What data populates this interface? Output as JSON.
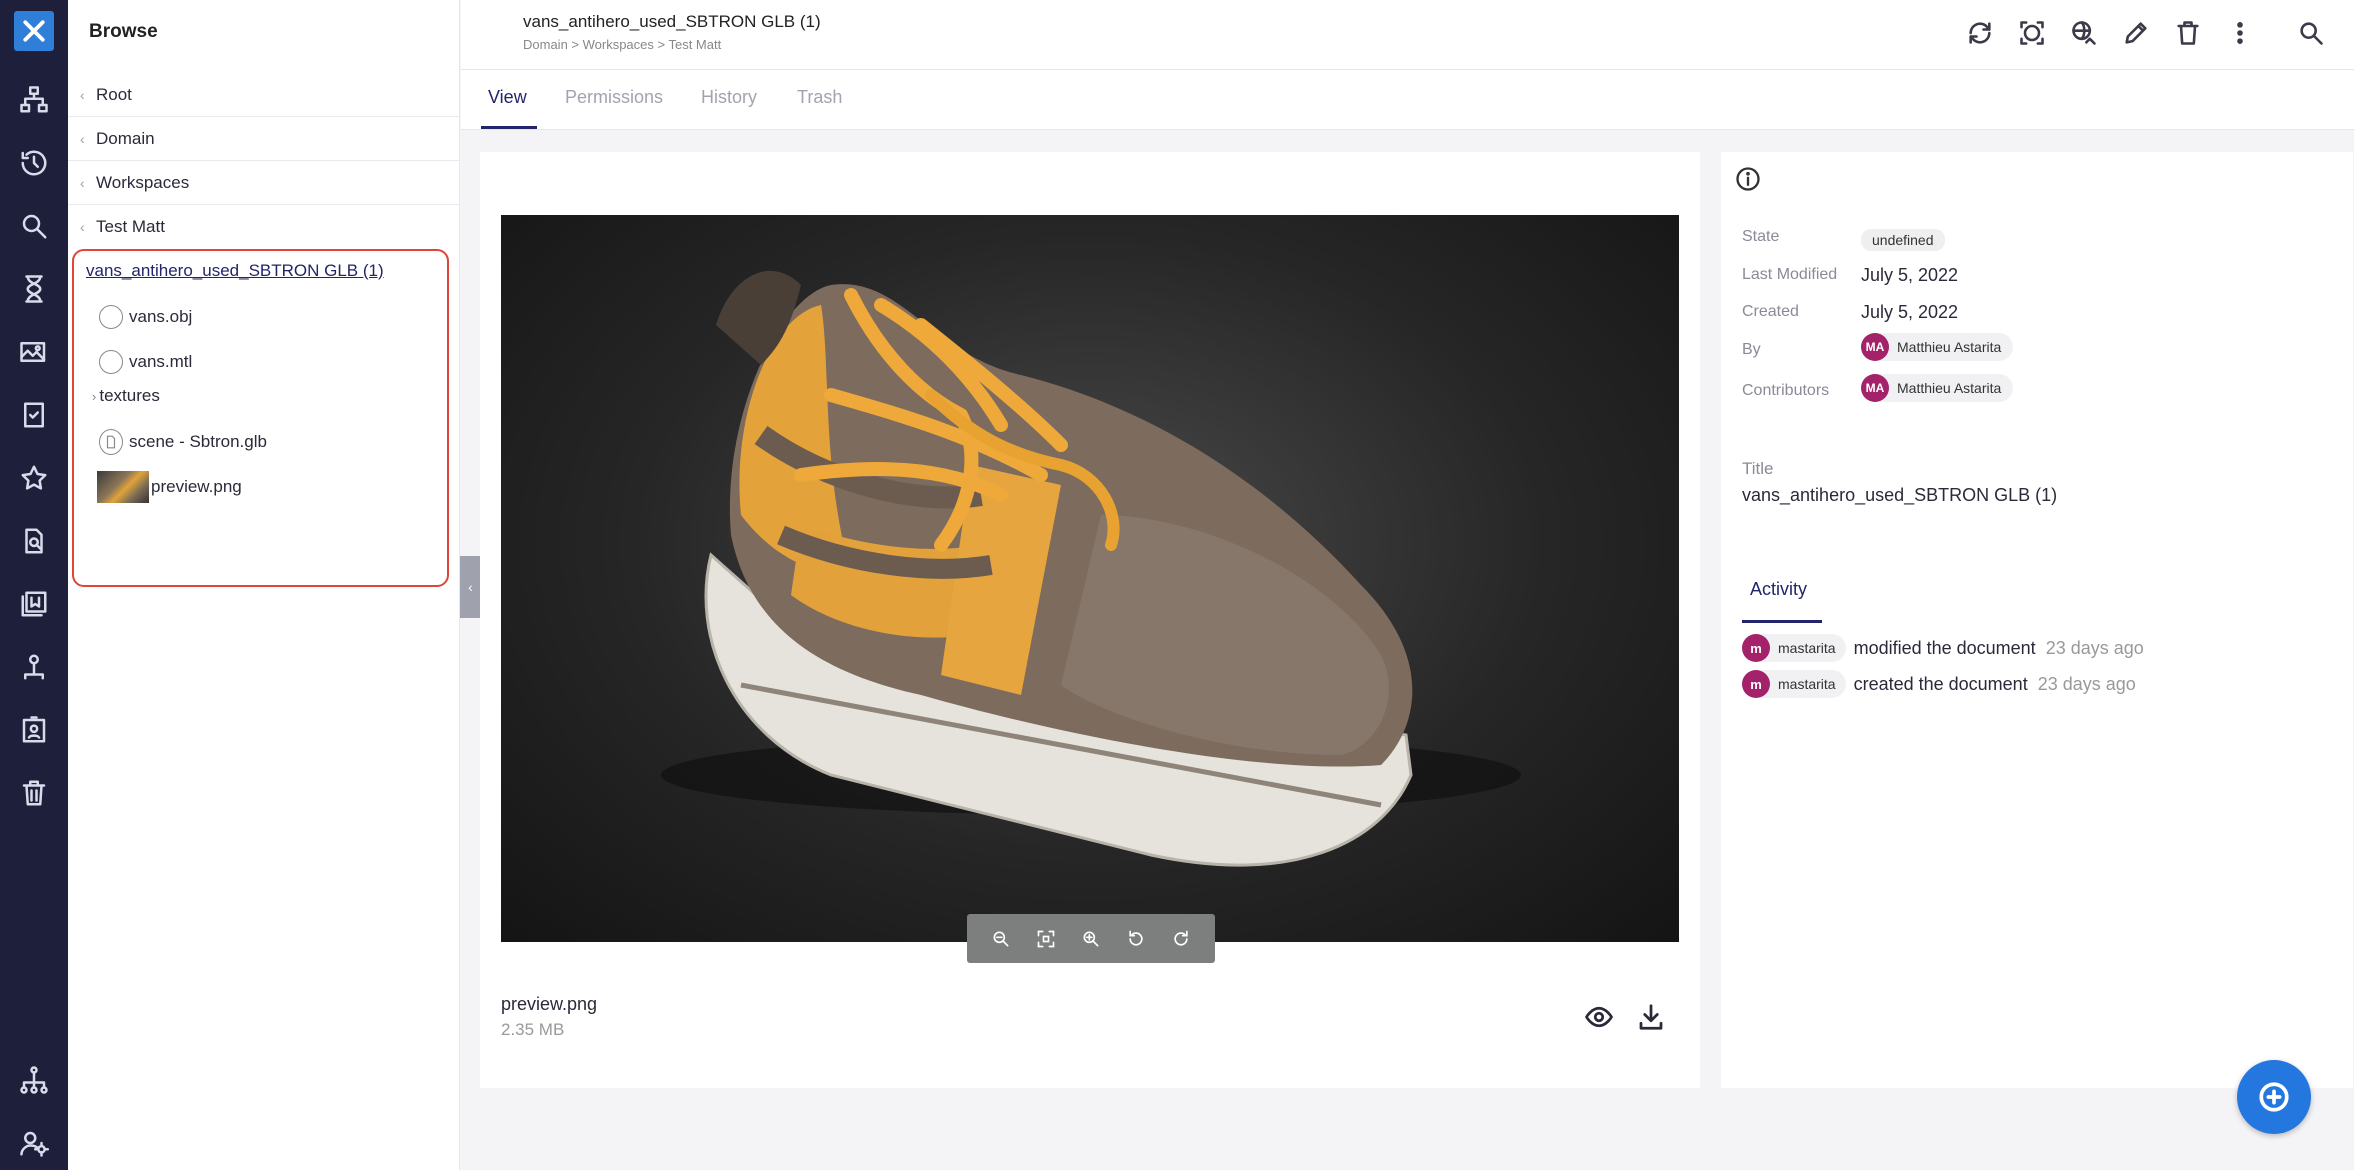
{
  "rail": {
    "items": [
      "logo-icon",
      "hierarchy-icon",
      "history-icon",
      "search-icon",
      "hourglass-icon",
      "images-icon",
      "clipboard-check-icon",
      "star-icon",
      "document-search-icon",
      "library-icon",
      "user-tree-icon",
      "badge-icon",
      "trash-icon",
      "network-icon",
      "user-settings-icon"
    ]
  },
  "browse": {
    "title": "Browse",
    "breadcrumbs": [
      "Root",
      "Domain",
      "Workspaces",
      "Test Matt"
    ],
    "tree": {
      "root": "vans_antihero_used_SBTRON GLB (1)",
      "children": [
        {
          "label": "vans.obj",
          "icon": "folder-icon"
        },
        {
          "label": "vans.mtl",
          "icon": "folder-icon"
        },
        {
          "label": "textures",
          "icon": "chevron-right-icon"
        },
        {
          "label": "scene - Sbtron.glb",
          "icon": "file-icon"
        },
        {
          "label": "preview.png",
          "icon": "image-thumbnail"
        }
      ]
    }
  },
  "header": {
    "title": "vans_antihero_used_SBTRON GLB (1)",
    "path": "Domain > Workspaces > Test Matt",
    "actions": [
      "sync-icon",
      "focus-icon",
      "publish-icon",
      "edit-icon",
      "delete-icon",
      "more-icon",
      "search-icon"
    ]
  },
  "tabs": {
    "view": "View",
    "permissions": "Permissions",
    "history": "History",
    "trash": "Trash"
  },
  "preview": {
    "file_name": "preview.png",
    "file_size": "2.35 MB",
    "zoom_controls": [
      "zoom-out-icon",
      "fit-screen-icon",
      "zoom-in-icon",
      "rotate-left-icon",
      "rotate-right-icon"
    ]
  },
  "info": {
    "state_label": "State",
    "state_value": "undefined",
    "last_modified_label": "Last Modified",
    "last_modified_value": "July 5, 2022",
    "created_label": "Created",
    "created_value": "July 5, 2022",
    "by_label": "By",
    "by_initials": "MA",
    "by_name": "Matthieu Astarita",
    "contributors_label": "Contributors",
    "contributors_initials": "MA",
    "contributors_name": "Matthieu Astarita",
    "title_label": "Title",
    "title_value": "vans_antihero_used_SBTRON GLB (1)",
    "activity_label": "Activity",
    "activity": [
      {
        "initial": "m",
        "user": "mastarita",
        "action": "modified the document",
        "time": "23 days ago"
      },
      {
        "initial": "m",
        "user": "mastarita",
        "action": "created the document",
        "time": "23 days ago"
      }
    ]
  },
  "colors": {
    "rail_bg": "#1d1f3b",
    "accent": "#23246b",
    "fab": "#2577e0",
    "avatar": "#a3226a",
    "highlight_border": "#e0443a"
  }
}
